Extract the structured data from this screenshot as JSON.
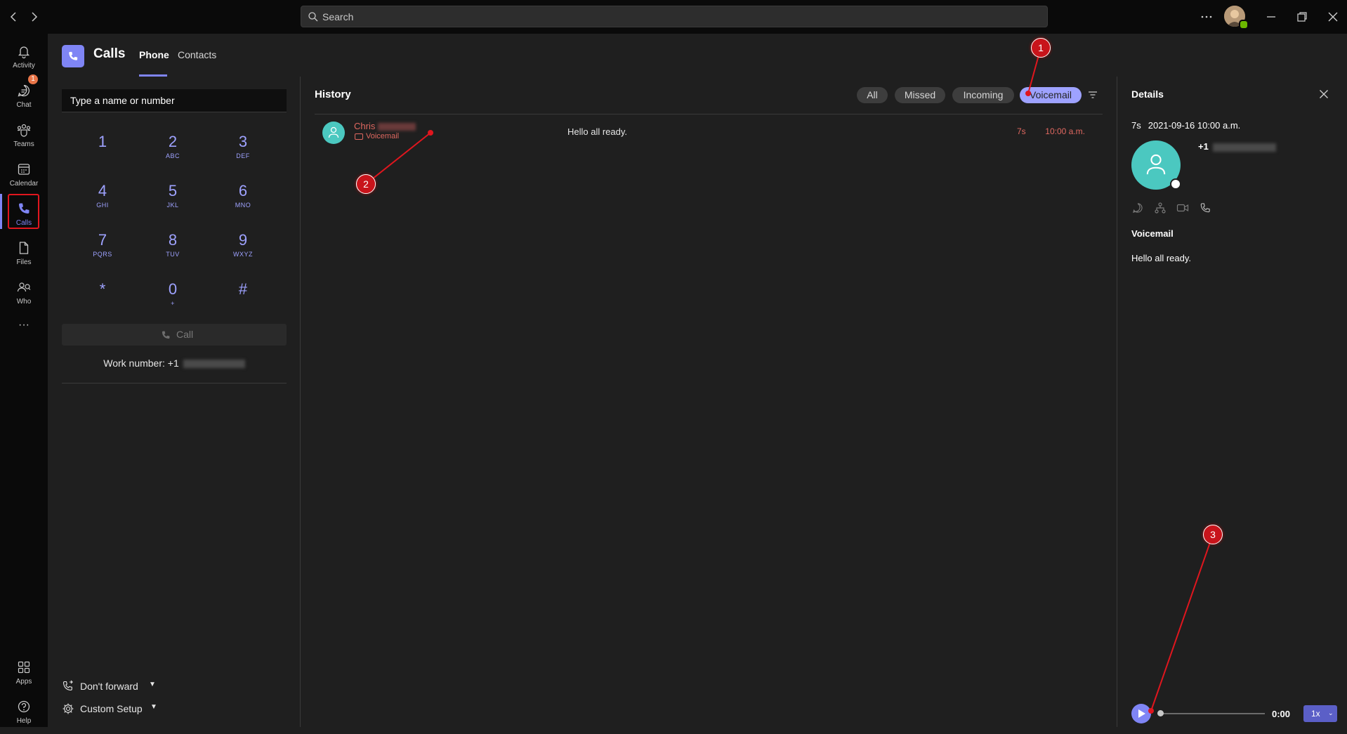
{
  "search": {
    "placeholder": "Search"
  },
  "rail": {
    "items": [
      {
        "label": "Activity",
        "icon": "bell-icon"
      },
      {
        "label": "Chat",
        "icon": "chat-icon",
        "badge": "1"
      },
      {
        "label": "Teams",
        "icon": "teams-icon"
      },
      {
        "label": "Calendar",
        "icon": "calendar-icon"
      },
      {
        "label": "Calls",
        "icon": "phone-icon",
        "active": true
      },
      {
        "label": "Files",
        "icon": "file-icon"
      },
      {
        "label": "Who",
        "icon": "who-icon"
      }
    ],
    "more": "···",
    "bottom": [
      {
        "label": "Apps",
        "icon": "apps-icon"
      },
      {
        "label": "Help",
        "icon": "help-icon"
      }
    ]
  },
  "header": {
    "title": "Calls",
    "tabs": [
      "Phone",
      "Contacts"
    ]
  },
  "dialpad": {
    "placeholder": "Type a name or number",
    "keys": [
      {
        "digit": "1",
        "letters": ""
      },
      {
        "digit": "2",
        "letters": "ABC"
      },
      {
        "digit": "3",
        "letters": "DEF"
      },
      {
        "digit": "4",
        "letters": "GHI"
      },
      {
        "digit": "5",
        "letters": "JKL"
      },
      {
        "digit": "6",
        "letters": "MNO"
      },
      {
        "digit": "7",
        "letters": "PQRS"
      },
      {
        "digit": "8",
        "letters": "TUV"
      },
      {
        "digit": "9",
        "letters": "WXYZ"
      },
      {
        "digit": "*",
        "letters": ""
      },
      {
        "digit": "0",
        "letters": "+"
      },
      {
        "digit": "#",
        "letters": ""
      }
    ],
    "call_label": "Call",
    "work_number_label": "Work number: +1",
    "forward_label": "Don't forward",
    "setup_label": "Custom Setup"
  },
  "history": {
    "title": "History",
    "filters": [
      "All",
      "Missed",
      "Incoming",
      "Voicemail"
    ],
    "active_filter": "Voicemail",
    "rows": [
      {
        "name": "Chris",
        "type": "Voicemail",
        "message": "Hello all ready.",
        "duration": "7s",
        "time": "10:00 a.m."
      }
    ]
  },
  "details": {
    "title": "Details",
    "duration": "7s",
    "datetime": "2021-09-16 10:00 a.m.",
    "number_prefix": "+1",
    "section_label": "Voicemail",
    "transcript": "Hello all ready.",
    "player": {
      "time": "0:00",
      "speed": "1x",
      "progress": 0
    }
  },
  "annotations": [
    "1",
    "2",
    "3"
  ],
  "colors": {
    "accent": "#7f85f5",
    "missed": "#e06860",
    "avatar": "#4bc8c0",
    "annotation": "#c8141b"
  }
}
